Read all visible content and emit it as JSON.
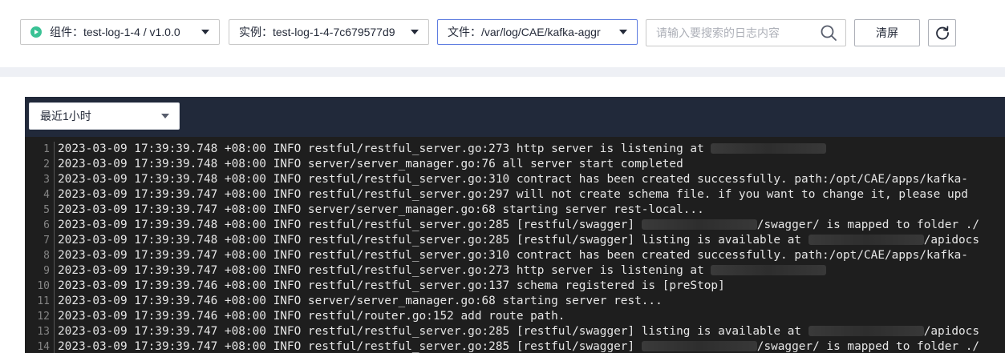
{
  "toolbar": {
    "component_select": {
      "label": "组件：",
      "value": "test-log-1-4 / v1.0.0"
    },
    "instance_select": {
      "label": "实例：",
      "value": "test-log-1-4-7c679577d9"
    },
    "file_select": {
      "label": "文件：",
      "value": "/var/log/CAE/kafka-aggr"
    },
    "search": {
      "placeholder": "请输入要搜索的日志内容",
      "value": ""
    },
    "clear_label": "清屏",
    "icons": {
      "status": "running-status-icon",
      "search": "search-icon",
      "refresh": "refresh-icon",
      "dropdown": "chevron-down-icon"
    }
  },
  "log_panel": {
    "time_range": "最近1小时",
    "lines": [
      {
        "no": "1",
        "parts": [
          {
            "t": "2023-03-09 17:39:39.748 +08:00 INFO restful/restful_server.go:273 http server is listening at "
          },
          {
            "redacted": true,
            "chars": 6
          }
        ]
      },
      {
        "no": "2",
        "parts": [
          {
            "t": "2023-03-09 17:39:39.748 +08:00 INFO server/server_manager.go:76 all server start completed"
          }
        ]
      },
      {
        "no": "3",
        "parts": [
          {
            "t": "2023-03-09 17:39:39.748 +08:00 INFO restful/restful_server.go:310 contract has been created successfully. path:/opt/CAE/apps/kafka-"
          }
        ]
      },
      {
        "no": "4",
        "parts": [
          {
            "t": "2023-03-09 17:39:39.747 +08:00 INFO restful/restful_server.go:297 will not create schema file. if you want to change it, please upd"
          }
        ]
      },
      {
        "no": "5",
        "parts": [
          {
            "t": "2023-03-09 17:39:39.747 +08:00 INFO server/server_manager.go:68 starting server rest-local..."
          }
        ]
      },
      {
        "no": "6",
        "parts": [
          {
            "t": "2023-03-09 17:39:39.748 +08:00 INFO restful/restful_server.go:285 [restful/swagger] "
          },
          {
            "redacted": true,
            "chars": 6
          },
          {
            "t": "/swagger/ is mapped to folder ./"
          }
        ]
      },
      {
        "no": "7",
        "parts": [
          {
            "t": "2023-03-09 17:39:39.748 +08:00 INFO restful/restful_server.go:285 [restful/swagger] listing is available at "
          },
          {
            "redacted": true,
            "chars": 6
          },
          {
            "t": "/apidocs"
          }
        ]
      },
      {
        "no": "8",
        "parts": [
          {
            "t": "2023-03-09 17:39:39.747 +08:00 INFO restful/restful_server.go:310 contract has been created successfully. path:/opt/CAE/apps/kafka-"
          }
        ]
      },
      {
        "no": "9",
        "parts": [
          {
            "t": "2023-03-09 17:39:39.747 +08:00 INFO restful/restful_server.go:273 http server is listening at "
          },
          {
            "redacted": true,
            "chars": 6
          }
        ]
      },
      {
        "no": "10",
        "parts": [
          {
            "t": "2023-03-09 17:39:39.746 +08:00 INFO restful/restful_server.go:137 schema registered is [preStop]"
          }
        ]
      },
      {
        "no": "11",
        "parts": [
          {
            "t": "2023-03-09 17:39:39.746 +08:00 INFO server/server_manager.go:68 starting server rest..."
          }
        ]
      },
      {
        "no": "12",
        "parts": [
          {
            "t": "2023-03-09 17:39:39.746 +08:00 INFO restful/router.go:152 add route path."
          }
        ]
      },
      {
        "no": "13",
        "parts": [
          {
            "t": "2023-03-09 17:39:39.747 +08:00 INFO restful/restful_server.go:285 [restful/swagger] listing is available at "
          },
          {
            "redacted": true,
            "chars": 6
          },
          {
            "t": "/apidocs"
          }
        ]
      },
      {
        "no": "14",
        "parts": [
          {
            "t": "2023-03-09 17:39:39.747 +08:00 INFO restful/restful_server.go:285 [restful/swagger] "
          },
          {
            "redacted": true,
            "chars": 6
          },
          {
            "t": "/swagger/ is mapped to folder ./"
          }
        ]
      }
    ]
  }
}
